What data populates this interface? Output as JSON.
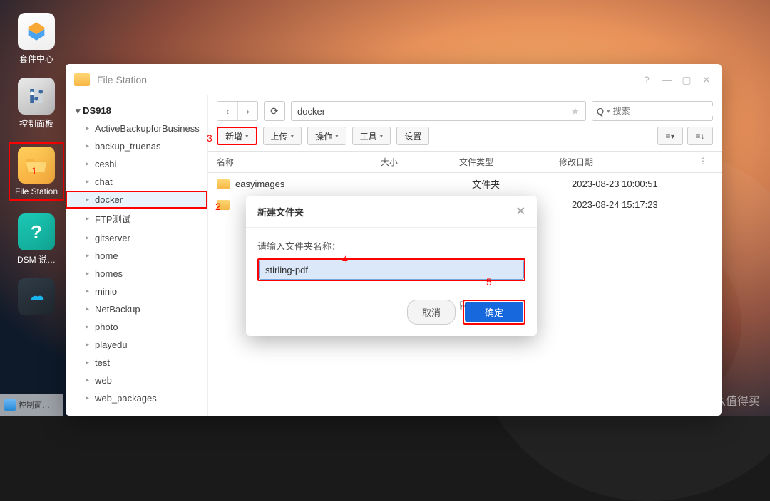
{
  "desktop": {
    "icons": [
      {
        "key": "pkg",
        "label": "套件中心"
      },
      {
        "key": "ctrl",
        "label": "控制面板"
      },
      {
        "key": "fs",
        "label": "File Station"
      },
      {
        "key": "dsm",
        "label": "DSM 说…"
      },
      {
        "key": "misc",
        "label": ""
      }
    ],
    "taskbar_label": "控制面…"
  },
  "annotations": {
    "n1": "1",
    "n2": "2",
    "n3": "3",
    "n4": "4",
    "n5": "5"
  },
  "window": {
    "title": "File Station",
    "help_glyph": "?",
    "min_glyph": "—",
    "max_glyph": "▢",
    "close_glyph": "✕"
  },
  "sidebar": {
    "root": "DS918",
    "items": [
      "ActiveBackupforBusiness",
      "backup_truenas",
      "ceshi",
      "chat",
      "docker",
      "FTP测试",
      "gitserver",
      "home",
      "homes",
      "minio",
      "NetBackup",
      "photo",
      "playedu",
      "test",
      "web",
      "web_packages"
    ],
    "selected": "docker"
  },
  "toolbar": {
    "back": "‹",
    "fwd": "›",
    "refresh": "⟳",
    "path": "docker",
    "star": "★",
    "search_glyph": "Q",
    "search_chev": "▾",
    "search_placeholder": "搜索",
    "btn_new": "新增",
    "btn_upload": "上传",
    "btn_action": "操作",
    "btn_tool": "工具",
    "btn_settings": "设置",
    "view_list": "≡▾",
    "view_sort": "≡↓"
  },
  "columns": {
    "name": "名称",
    "size": "大小",
    "type": "文件类型",
    "date": "修改日期",
    "more": "⋮"
  },
  "rows": [
    {
      "name": "easyimages",
      "type": "文件夹",
      "date": "2023-08-23 10:00:51"
    },
    {
      "name": "",
      "type": "",
      "date": "2023-08-24 15:17:23"
    }
  ],
  "dialog": {
    "title": "新建文件夹",
    "close": "✕",
    "prompt": "请输入文件夹名称：",
    "value": "stirling-pdf",
    "cancel": "取消",
    "ok": "确定"
  },
  "watermark": {
    "sym": "值",
    "text": "什么值得买"
  }
}
